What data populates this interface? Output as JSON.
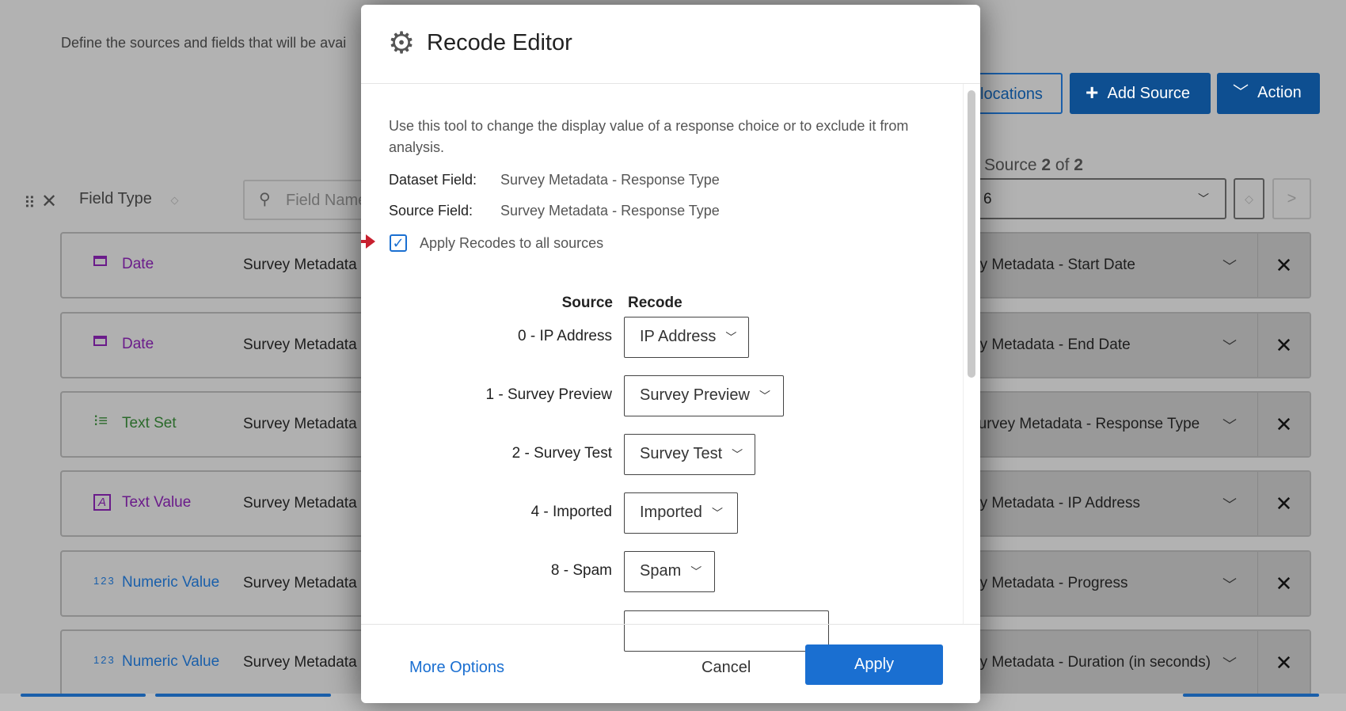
{
  "background": {
    "intro": "Define the sources and fields that will be avai",
    "toolbar": {
      "field_type": "Field Type",
      "search_placeholder": "Field Name"
    },
    "buttons": {
      "allocations": "locations",
      "add_source": "Add Source",
      "action": "Action"
    },
    "source_pager": {
      "label": "Source",
      "current": "2",
      "of": "of",
      "total": "2",
      "select_value": "6"
    },
    "rows": [
      {
        "type": "Date",
        "type_icon": "calendar-icon",
        "color": "purple",
        "field": "Survey Metadata -",
        "mapped": "ey Metadata - Start Date"
      },
      {
        "type": "Date",
        "type_icon": "calendar-icon",
        "color": "purple",
        "field": "Survey Metadata -",
        "mapped": "ey Metadata - End Date"
      },
      {
        "type": "Text Set",
        "type_icon": "list-icon",
        "color": "green",
        "field": "Survey Metadata -",
        "mapped": "Survey Metadata - Response Type"
      },
      {
        "type": "Text Value",
        "type_icon": "text-icon",
        "color": "purple",
        "field": "Survey Metadata -",
        "mapped": "ey Metadata - IP Address"
      },
      {
        "type": "Numeric Value",
        "type_icon": "numeric-icon",
        "color": "blue",
        "field": "Survey Metadata -",
        "mapped": "ey Metadata - Progress"
      },
      {
        "type": "Numeric Value",
        "type_icon": "numeric-icon",
        "color": "blue",
        "field": "Survey Metadata -",
        "mapped": "ey Metadata - Duration (in seconds)"
      }
    ]
  },
  "modal": {
    "title": "Recode Editor",
    "description": "Use this tool to change the display value of a response choice or to exclude it from analysis.",
    "dataset_field_label": "Dataset Field:",
    "dataset_field_value": "Survey Metadata - Response Type",
    "source_field_label": "Source Field:",
    "source_field_value": "Survey Metadata - Response Type",
    "apply_all_label": "Apply Recodes to all sources",
    "apply_all_checked": true,
    "col_source": "Source",
    "col_recode": "Recode",
    "recodes": [
      {
        "source": "0 - IP Address",
        "recode": "IP Address"
      },
      {
        "source": "1 - Survey Preview",
        "recode": "Survey Preview"
      },
      {
        "source": "2 - Survey Test",
        "recode": "Survey Test"
      },
      {
        "source": "4 - Imported",
        "recode": "Imported"
      },
      {
        "source": "8 - Spam",
        "recode": "Spam"
      }
    ],
    "footer": {
      "more_options": "More Options",
      "cancel": "Cancel",
      "apply": "Apply"
    }
  }
}
